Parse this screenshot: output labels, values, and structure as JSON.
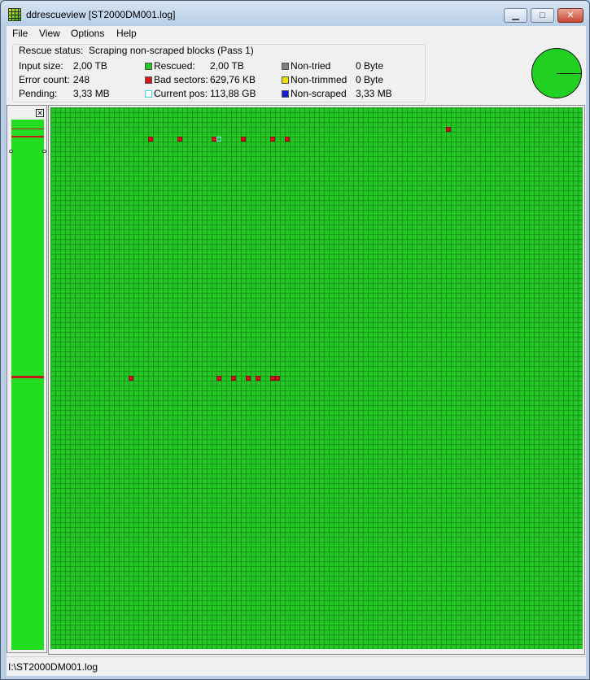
{
  "window": {
    "title": "ddrescueview [ST2000DM001.log]"
  },
  "window_controls": {
    "minimize": "▁",
    "maximize": "□",
    "close": "✕"
  },
  "menu": [
    {
      "label": "File"
    },
    {
      "label": "View"
    },
    {
      "label": "Options"
    },
    {
      "label": "Help"
    }
  ],
  "info": {
    "rescue_status_label": "Rescue status:",
    "rescue_status_value": "Scraping non-scraped blocks (Pass 1)",
    "input_size_label": "Input size:",
    "input_size_value": "2,00 TB",
    "error_count_label": "Error count:",
    "error_count_value": "248",
    "pending_label": "Pending:",
    "pending_value": "3,33 MB",
    "legend": [
      {
        "label": "Rescued:",
        "value": "2,00 TB",
        "color": "#22c822",
        "icon": "rescued-swatch"
      },
      {
        "label": "Bad sectors:",
        "value": "629,76 KB",
        "color": "#d01818",
        "icon": "bad-sectors-swatch"
      },
      {
        "label": "Current pos:",
        "value": "113,88 GB",
        "color": "#7cf0f0",
        "icon": "current-pos-swatch"
      },
      {
        "label": "Non-tried",
        "value": "0 Byte",
        "color": "#808080",
        "icon": "non-tried-swatch"
      },
      {
        "label": "Non-trimmed",
        "value": "0 Byte",
        "color": "#f0e000",
        "icon": "non-trimmed-swatch"
      },
      {
        "label": "Non-scraped",
        "value": "3,33 MB",
        "color": "#1a1ad0",
        "icon": "non-scraped-swatch"
      }
    ]
  },
  "sidebar": {
    "close_glyph": "✕"
  },
  "statusbar": {
    "path": "I:\\ST2000DM001.log"
  },
  "colors": {
    "rescued": "#22c822",
    "bad": "#d01818",
    "grid_line": "#1f8f1f"
  }
}
